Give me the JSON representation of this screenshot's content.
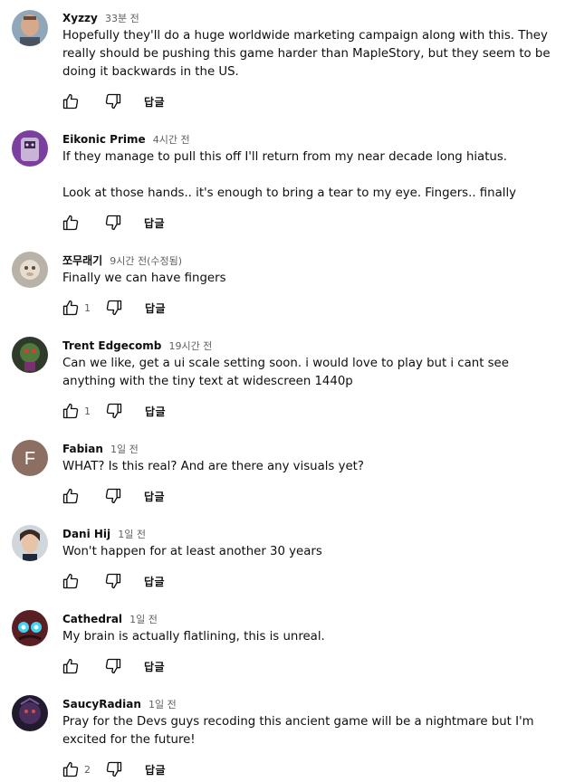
{
  "comments": [
    {
      "author": "Xyzzy",
      "time": "33분 전",
      "paragraphs": [
        "Hopefully they'll do a huge worldwide marketing campaign along with this. They really should be pushing this game harder than MapleStory, but they seem to be doing it backwards in the US."
      ],
      "likes": "",
      "reply_label": "답글"
    },
    {
      "author": "Eikonic Prime",
      "time": "4시간 전",
      "paragraphs": [
        "If they manage to pull this off I'll return from my near decade long hiatus.",
        "Look at those hands.. it's enough to bring a tear to my eye. Fingers.. finally"
      ],
      "likes": "",
      "reply_label": "답글"
    },
    {
      "author": "쪼무래기",
      "time": "9시간 전(수정됨)",
      "paragraphs": [
        "Finally we can have fingers"
      ],
      "likes": "1",
      "reply_label": "답글"
    },
    {
      "author": "Trent Edgecomb",
      "time": "19시간 전",
      "paragraphs": [
        "Can we like, get a ui scale setting soon. i would love to play but i cant see anything with the tiny text at widescreen 1440p"
      ],
      "likes": "1",
      "reply_label": "답글"
    },
    {
      "author": "Fabian",
      "time": "1일 전",
      "avatar_letter": "F",
      "paragraphs": [
        "WHAT? Is this real? And are there any visuals yet?"
      ],
      "likes": "",
      "reply_label": "답글"
    },
    {
      "author": "Dani Hij",
      "time": "1일 전",
      "paragraphs": [
        "Won't happen for at least another 30 years"
      ],
      "likes": "",
      "reply_label": "답글"
    },
    {
      "author": "Cathedral",
      "time": "1일 전",
      "paragraphs": [
        "My brain is actually flatlining, this is unreal."
      ],
      "likes": "",
      "reply_label": "답글"
    },
    {
      "author": "SaucyRadian",
      "time": "1일 전",
      "paragraphs": [
        "Pray for the Devs guys recoding this ancient game will be a nightmare but I'm excited for the future!"
      ],
      "likes": "2",
      "reply_label": "답글"
    }
  ],
  "icons": {
    "like": "thumbs-up-icon",
    "dislike": "thumbs-down-icon"
  },
  "colors": {
    "text": "#0f0f0f",
    "secondary": "#606060",
    "fabian_avatar": "#8d6e63"
  }
}
